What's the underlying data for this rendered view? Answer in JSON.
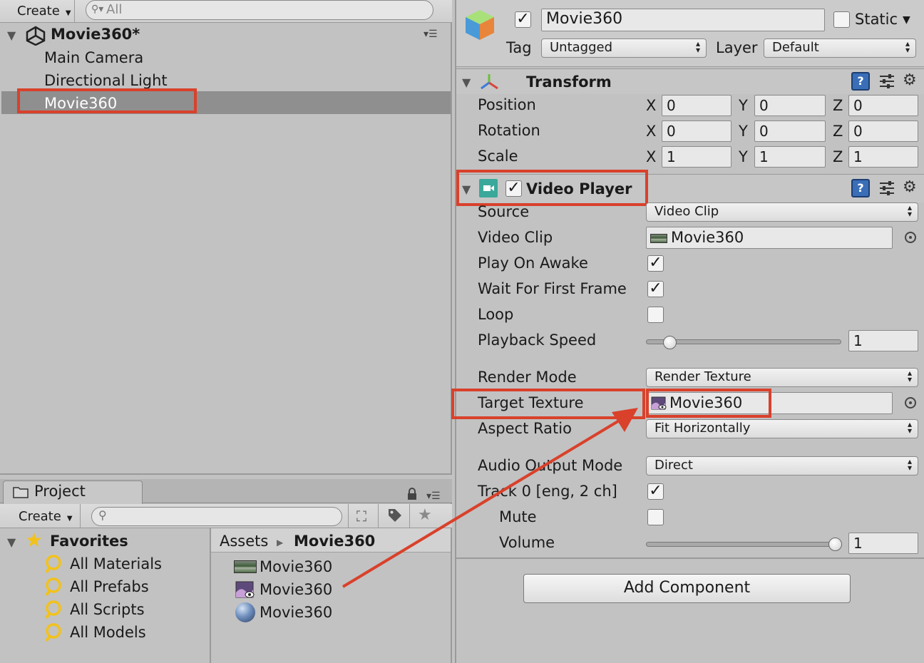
{
  "hierarchy": {
    "create_label": "Create",
    "search_placeholder": "All",
    "scene_name": "Movie360*",
    "items": [
      "Main Camera",
      "Directional Light",
      "Movie360"
    ]
  },
  "project": {
    "tab_label": "Project",
    "create_label": "Create",
    "favorites_label": "Favorites",
    "favorites": [
      "All Materials",
      "All Prefabs",
      "All Scripts",
      "All Models"
    ],
    "breadcrumb": {
      "root": "Assets",
      "folder": "Movie360"
    },
    "assets": [
      {
        "name": "Movie360",
        "icon": "video-clip-icon"
      },
      {
        "name": "Movie360",
        "icon": "render-texture-icon"
      },
      {
        "name": "Movie360",
        "icon": "material-sphere-icon"
      }
    ]
  },
  "inspector": {
    "object_name": "Movie360",
    "static_label": "Static",
    "tag_label": "Tag",
    "tag_value": "Untagged",
    "layer_label": "Layer",
    "layer_value": "Default",
    "transform": {
      "title": "Transform",
      "rows": [
        {
          "label": "Position",
          "x": "0",
          "y": "0",
          "z": "0"
        },
        {
          "label": "Rotation",
          "x": "0",
          "y": "0",
          "z": "0"
        },
        {
          "label": "Scale",
          "x": "1",
          "y": "1",
          "z": "1"
        }
      ],
      "axis": {
        "x": "X",
        "y": "Y",
        "z": "Z"
      }
    },
    "video_player": {
      "title": "Video Player",
      "source_label": "Source",
      "source_value": "Video Clip",
      "video_clip_label": "Video Clip",
      "video_clip_value": "Movie360",
      "play_on_awake_label": "Play On Awake",
      "wait_first_frame_label": "Wait For First Frame",
      "loop_label": "Loop",
      "playback_speed_label": "Playback Speed",
      "playback_speed_value": "1",
      "render_mode_label": "Render Mode",
      "render_mode_value": "Render Texture",
      "target_texture_label": "Target Texture",
      "target_texture_value": "Movie360",
      "aspect_ratio_label": "Aspect Ratio",
      "aspect_ratio_value": "Fit Horizontally",
      "audio_output_label": "Audio Output Mode",
      "audio_output_value": "Direct",
      "track_label": "Track 0 [eng, 2 ch]",
      "mute_label": "Mute",
      "volume_label": "Volume",
      "volume_value": "1"
    },
    "add_component_label": "Add Component"
  },
  "colors": {
    "annotation": "#d9412b",
    "selection": "#8f8f8f",
    "panel": "#c2c2c2"
  }
}
